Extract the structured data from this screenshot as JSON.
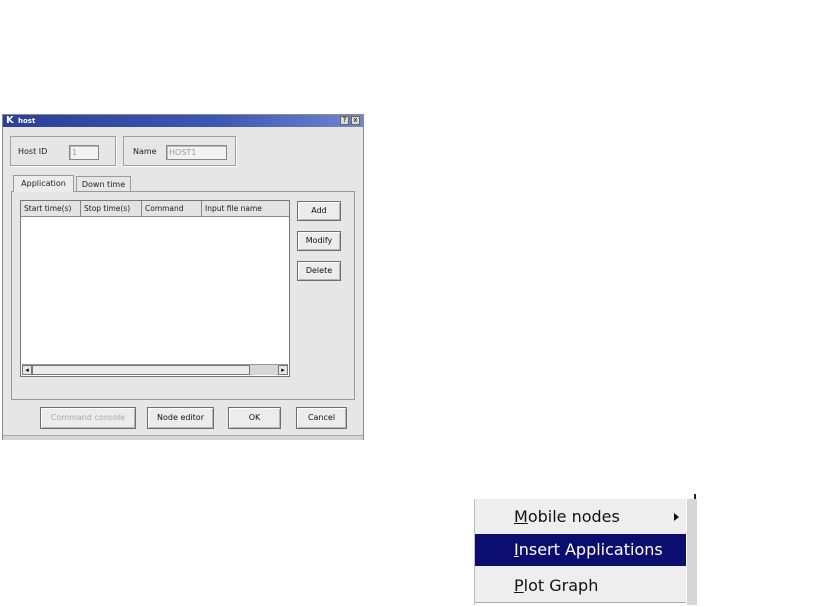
{
  "dialog": {
    "title": "host",
    "title_icon": "K",
    "help_button": "?",
    "close_button": "x",
    "host_id": {
      "label": "Host ID",
      "value": "1"
    },
    "name": {
      "label": "Name",
      "value": "HOST1"
    },
    "tabs": [
      {
        "label": "Application",
        "active": true
      },
      {
        "label": "Down time",
        "active": false
      }
    ],
    "table": {
      "columns": [
        "Start time(s)",
        "Stop time(s)",
        "Command",
        "Input file name"
      ],
      "rows": []
    },
    "side_buttons": {
      "add": "Add",
      "modify": "Modify",
      "delete": "Delete"
    },
    "bottom_buttons": {
      "command_console": "Command console",
      "node_editor": "Node editor",
      "ok": "OK",
      "cancel": "Cancel"
    }
  },
  "context_menu": {
    "items": [
      {
        "label": "Mobile nodes",
        "accel": "M",
        "rest": "obile nodes",
        "has_submenu": true,
        "selected": false
      },
      {
        "label": "Insert Applications",
        "accel": "I",
        "rest": "nsert Applications",
        "has_submenu": false,
        "selected": true
      },
      {
        "label": "Plot Graph",
        "accel": "P",
        "rest": "lot Graph",
        "has_submenu": false,
        "selected": false
      }
    ]
  },
  "colors": {
    "titlebar": "#2a3f9a",
    "menu_selected": "#0b0e6e",
    "dialog_bg": "#e6e6e6"
  }
}
